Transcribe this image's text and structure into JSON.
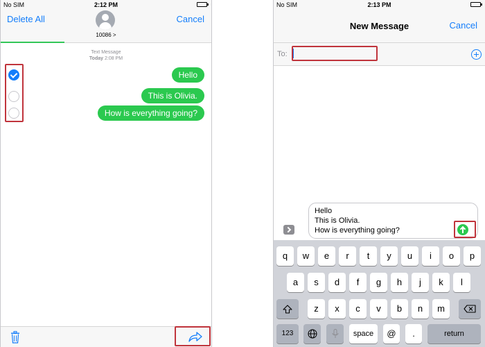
{
  "left_phone": {
    "status": {
      "carrier": "No SIM",
      "time": "2:12 PM"
    },
    "header": {
      "delete_all_label": "Delete All",
      "cancel_label": "Cancel",
      "contact_number": "10086 >"
    },
    "thread_meta": {
      "service": "Text Message",
      "day": "Today",
      "time": "2:08 PM"
    },
    "messages": [
      {
        "text": "Hello",
        "selected": true
      },
      {
        "text": "This is Olivia.",
        "selected": false
      },
      {
        "text": "How is everything going?",
        "selected": false
      }
    ],
    "toolbar": {
      "delete_icon": "trash-icon",
      "forward_icon": "forward-arrow-icon"
    }
  },
  "right_phone": {
    "status": {
      "carrier": "No SIM",
      "time": "2:13 PM"
    },
    "header": {
      "title": "New Message",
      "cancel_label": "Cancel"
    },
    "to_field": {
      "label": "To:",
      "value": ""
    },
    "compose": {
      "lines": [
        "Hello",
        "This is Olivia.",
        "How is everything going?"
      ]
    },
    "keyboard": {
      "row1": [
        "q",
        "w",
        "e",
        "r",
        "t",
        "y",
        "u",
        "i",
        "o",
        "p"
      ],
      "row2": [
        "a",
        "s",
        "d",
        "f",
        "g",
        "h",
        "j",
        "k",
        "l"
      ],
      "row3": [
        "z",
        "x",
        "c",
        "v",
        "b",
        "n",
        "m"
      ],
      "num_label": "123",
      "space_label": "space",
      "at_label": "@",
      "dot_label": ".",
      "return_label": "return"
    }
  },
  "colors": {
    "accent_blue": "#147efb",
    "bubble_green": "#2bc94f",
    "highlight_red": "#c0343c"
  }
}
